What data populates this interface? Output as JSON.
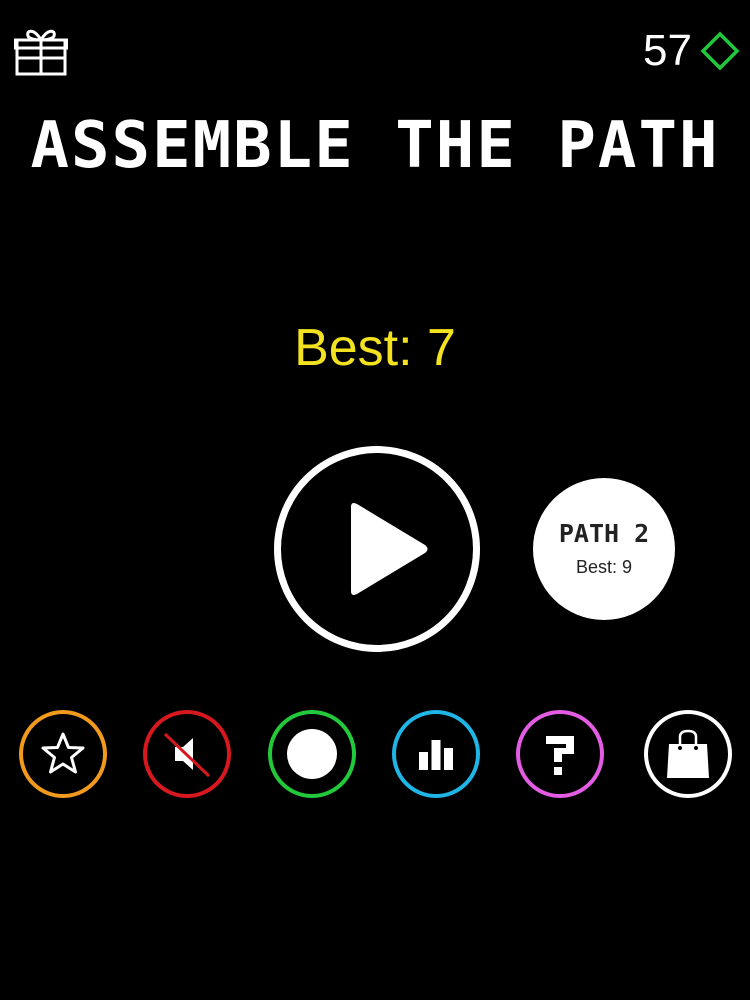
{
  "header": {
    "gift_icon": "gift-icon",
    "gem_count": "57",
    "gem_icon": "diamond-icon",
    "gem_color": "#21c93a"
  },
  "title": "ASSEMBLE THE PATH",
  "best": {
    "label": "Best: 7",
    "color": "#f3e21f"
  },
  "play_button": {
    "icon": "play-icon"
  },
  "path_button": {
    "name": "PATH 2",
    "best": "Best: 9"
  },
  "bottom_buttons": [
    {
      "icon": "star-icon",
      "color": "#f29a1e"
    },
    {
      "icon": "sound-muted-icon",
      "color": "#d7191f"
    },
    {
      "icon": "circle-icon",
      "color": "#22c93a"
    },
    {
      "icon": "leaderboard-icon",
      "color": "#1fb5e6"
    },
    {
      "icon": "help-icon",
      "color": "#e45ce3"
    },
    {
      "icon": "shopping-bag-icon",
      "color": "#ffffff"
    }
  ]
}
